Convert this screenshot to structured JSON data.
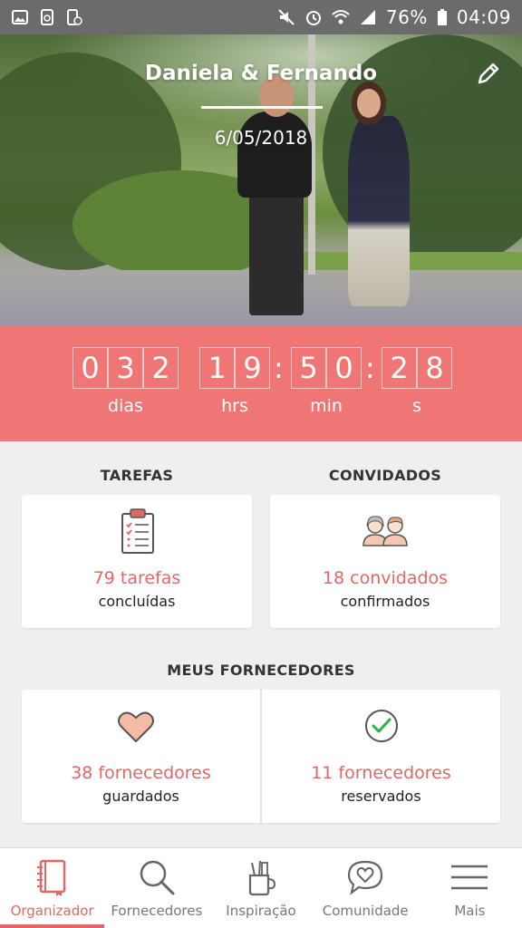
{
  "status_bar": {
    "battery": "76%",
    "time": "04:09"
  },
  "header": {
    "couple_names": "Daniela & Fernando",
    "date": "6/05/2018"
  },
  "countdown": {
    "days_digits": [
      "0",
      "3",
      "2"
    ],
    "hours_digits": [
      "1",
      "9"
    ],
    "minutes_digits": [
      "5",
      "0"
    ],
    "seconds_digits": [
      "2",
      "8"
    ],
    "separator": ":",
    "labels": {
      "days": "dias",
      "hours": "hrs",
      "minutes": "min",
      "seconds": "s"
    }
  },
  "tasks": {
    "title": "TAREFAS",
    "count": "79 tarefas",
    "subtitle": "concluídas"
  },
  "guests": {
    "title": "CONVIDADOS",
    "count": "18 convidados",
    "subtitle": "confirmados"
  },
  "vendors": {
    "title": "MEUS FORNECEDORES",
    "saved": {
      "count": "38 fornecedores",
      "subtitle": "guardados"
    },
    "booked": {
      "count": "11 fornecedores",
      "subtitle": "reservados"
    }
  },
  "bottom_nav": {
    "items": [
      {
        "label": "Organizador",
        "icon": "notebook-icon",
        "active": true
      },
      {
        "label": "Fornecedores",
        "icon": "search-icon",
        "active": false
      },
      {
        "label": "Inspiração",
        "icon": "pencil-cup-icon",
        "active": false
      },
      {
        "label": "Comunidade",
        "icon": "chat-heart-icon",
        "active": false
      },
      {
        "label": "Mais",
        "icon": "menu-icon",
        "active": false
      }
    ]
  },
  "colors": {
    "accent": "#f07575",
    "accent_text": "#e26767",
    "status_bar": "#6b6b6b",
    "background": "#efefef"
  }
}
